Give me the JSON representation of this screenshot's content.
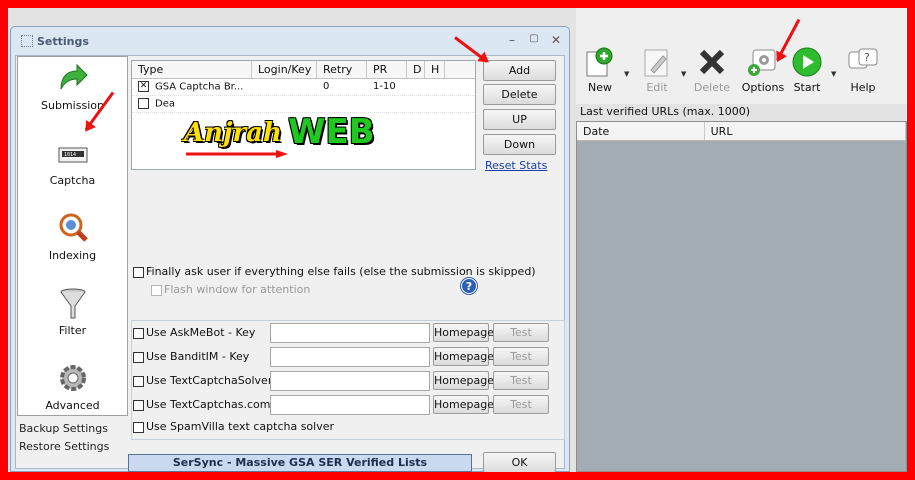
{
  "toolbar": {
    "new_label": "New",
    "edit_label": "Edit",
    "delete_label": "Delete",
    "options_label": "Options",
    "start_label": "Start",
    "help_label": "Help"
  },
  "verified": {
    "label": "Last verified URLs (max. 1000)",
    "columns": [
      "Date",
      "URL"
    ]
  },
  "settings": {
    "title": "Settings",
    "sidebar": {
      "items": [
        {
          "label": "Submission",
          "icon": "green-arrow-icon"
        },
        {
          "label": "Captcha",
          "icon": "captcha-icon"
        },
        {
          "label": "Indexing",
          "icon": "magnifier-icon"
        },
        {
          "label": "Filter",
          "icon": "funnel-icon"
        },
        {
          "label": "Advanced",
          "icon": "gear-icon"
        }
      ],
      "backup": "Backup Settings",
      "restore": "Restore Settings"
    },
    "grid": {
      "columns": [
        "Type",
        "Login/Key",
        "Retry",
        "PR",
        "D",
        "H"
      ],
      "rows": [
        {
          "checked": true,
          "type": "GSA Captcha Br...",
          "login": "",
          "retry": "0",
          "pr": "1-10"
        },
        {
          "checked": false,
          "type": "Dea",
          "login": "",
          "retry": "",
          "pr": ""
        }
      ]
    },
    "buttons": {
      "add": "Add",
      "delete": "Delete",
      "up": "UP",
      "down": "Down",
      "reset": "Reset Stats",
      "ok": "OK"
    },
    "watermark": {
      "part1": "Anjrah",
      "part2": "WEB"
    },
    "finally_ask": "Finally ask user if everything else fails (else the submission is skipped)",
    "flash_window": "Flash window for attention",
    "services": [
      {
        "label": "Use AskMeBot - Key",
        "homepage": "Homepage",
        "test": "Test"
      },
      {
        "label": "Use BanditIM - Key",
        "homepage": "Homepage",
        "test": "Test"
      },
      {
        "label": "Use TextCaptchaSolver",
        "homepage": "Homepage",
        "test": "Test"
      },
      {
        "label": "Use TextCaptchas.com",
        "homepage": "Homepage",
        "test": "Test"
      }
    ],
    "spamvilla": "Use SpamVilla text captcha solver",
    "sersync": "SerSync - Massive GSA SER Verified Lists"
  },
  "colors": {
    "border": "#ff0000",
    "annotation_arrow": "#ee1111",
    "grid_bg": "#a3acb3"
  }
}
